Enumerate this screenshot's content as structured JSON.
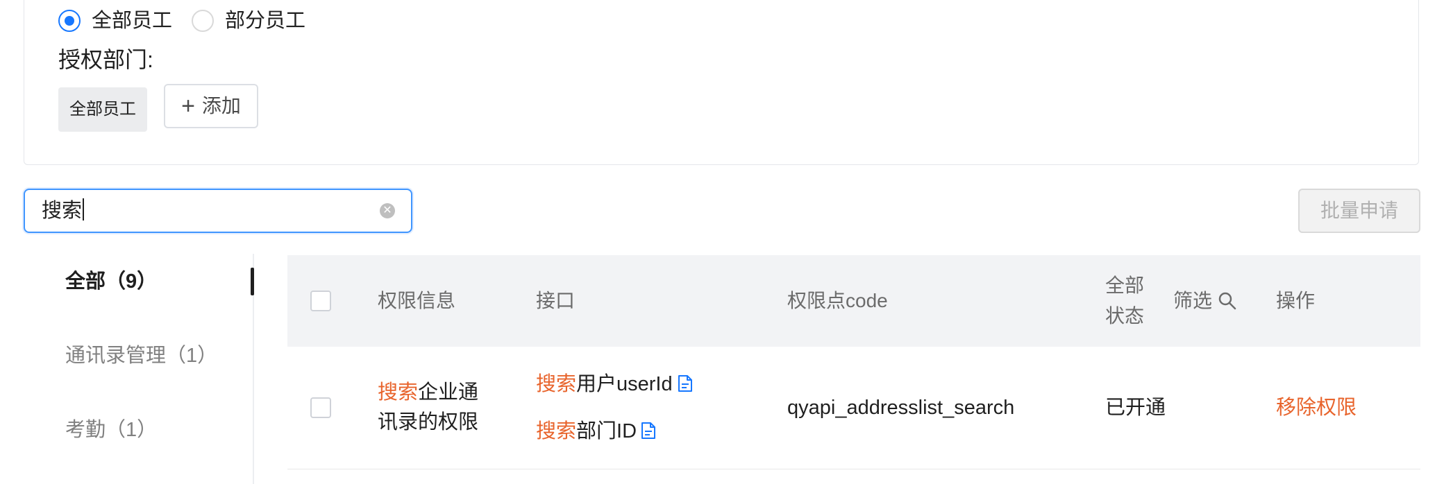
{
  "scope": {
    "options": [
      {
        "label": "全部员工",
        "selected": true
      },
      {
        "label": "部分员工",
        "selected": false
      }
    ]
  },
  "dept": {
    "label": "授权部门:",
    "tags": [
      "全部员工"
    ],
    "add_label": "添加"
  },
  "search": {
    "value": "搜索"
  },
  "toolbar": {
    "batch_label": "批量申请"
  },
  "nav": {
    "items": [
      {
        "label": "全部（9）",
        "active": true
      },
      {
        "label": "通讯录管理（1）",
        "active": false
      },
      {
        "label": "考勤（1）",
        "active": false
      }
    ]
  },
  "table": {
    "headers": {
      "info": "权限信息",
      "api": "接口",
      "code": "权限点code",
      "status_line1": "全部",
      "status_line2": "状态",
      "filter": "筛选",
      "action": "操作"
    },
    "rows": [
      {
        "info_hl": "搜索",
        "info_rest_line1": "企业通",
        "info_line2": "讯录的权限",
        "apis": [
          {
            "hl": "搜索",
            "rest": "用户userId"
          },
          {
            "hl": "搜索",
            "rest": "部门ID"
          }
        ],
        "code": "qyapi_addresslist_search",
        "status": "已开通",
        "action": "移除权限"
      }
    ]
  },
  "colors": {
    "accent": "#1677ff",
    "highlight": "#e8642c",
    "header_bg": "#f2f3f5"
  }
}
